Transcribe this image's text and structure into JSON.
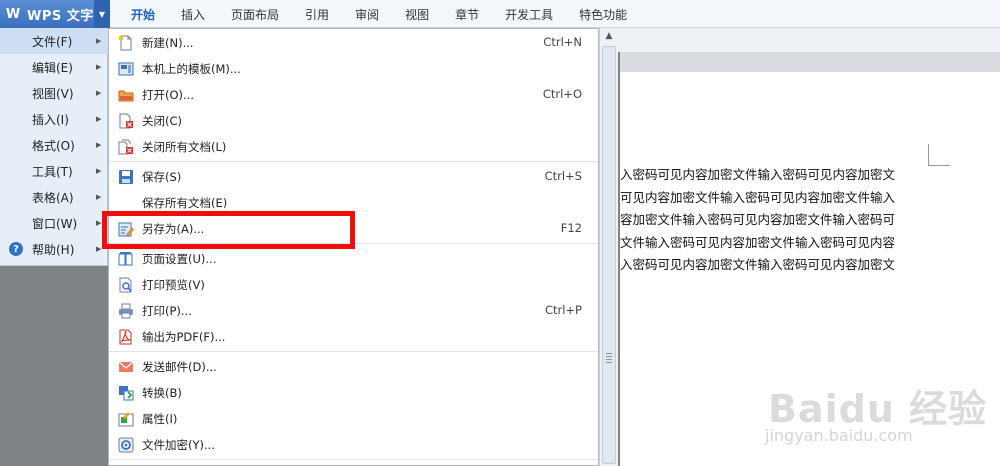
{
  "app": {
    "title": "WPS 文字"
  },
  "ribbon_tabs": [
    "开始",
    "插入",
    "页面布局",
    "引用",
    "审阅",
    "视图",
    "章节",
    "开发工具",
    "特色功能"
  ],
  "left_menu": [
    {
      "label": "文件(F)"
    },
    {
      "label": "编辑(E)"
    },
    {
      "label": "视图(V)"
    },
    {
      "label": "插入(I)"
    },
    {
      "label": "格式(O)"
    },
    {
      "label": "工具(T)"
    },
    {
      "label": "表格(A)"
    },
    {
      "label": "窗口(W)"
    },
    {
      "label": "帮助(H)"
    }
  ],
  "file_menu": [
    {
      "label": "新建(N)...",
      "shortcut": "Ctrl+N",
      "icon": "new-doc-icon"
    },
    {
      "label": "本机上的模板(M)...",
      "shortcut": "",
      "icon": "template-icon"
    },
    {
      "label": "打开(O)...",
      "shortcut": "Ctrl+O",
      "icon": "open-folder-icon"
    },
    {
      "label": "关闭(C)",
      "shortcut": "",
      "icon": "close-doc-icon"
    },
    {
      "label": "关闭所有文档(L)",
      "shortcut": "",
      "icon": "close-all-icon"
    },
    {
      "label": "保存(S)",
      "shortcut": "Ctrl+S",
      "icon": "save-icon"
    },
    {
      "label": "保存所有文档(E)",
      "shortcut": "",
      "icon": ""
    },
    {
      "label": "另存为(A)...",
      "shortcut": "F12",
      "icon": "save-as-icon"
    },
    {
      "label": "页面设置(U)...",
      "shortcut": "",
      "icon": "page-setup-icon"
    },
    {
      "label": "打印预览(V)",
      "shortcut": "",
      "icon": "print-preview-icon"
    },
    {
      "label": "打印(P)...",
      "shortcut": "Ctrl+P",
      "icon": "printer-icon"
    },
    {
      "label": "输出为PDF(F)...",
      "shortcut": "",
      "icon": "pdf-icon"
    },
    {
      "label": "发送邮件(D)...",
      "shortcut": "",
      "icon": "mail-icon"
    },
    {
      "label": "转换(B)",
      "shortcut": "",
      "icon": "convert-icon"
    },
    {
      "label": "属性(I)",
      "shortcut": "",
      "icon": "properties-icon"
    },
    {
      "label": "文件加密(Y)...",
      "shortcut": "",
      "icon": "encrypt-icon"
    }
  ],
  "document_lines": [
    "入密码可见内容加密文件输入密码可见内容加密文",
    "可见内容加密文件输入密码可见内容加密文件输入",
    "容加密文件输入密码可见内容加密文件输入密码可",
    "文件输入密码可见内容加密文件输入密码可见内容",
    "入密码可见内容加密文件输入密码可见内容加密文"
  ],
  "watermark": {
    "logo": "Baidu 经验",
    "url": "jingyan.baidu.com"
  },
  "colors": {
    "highlight": "#f20d0d",
    "accent": "#1f5fbf"
  }
}
